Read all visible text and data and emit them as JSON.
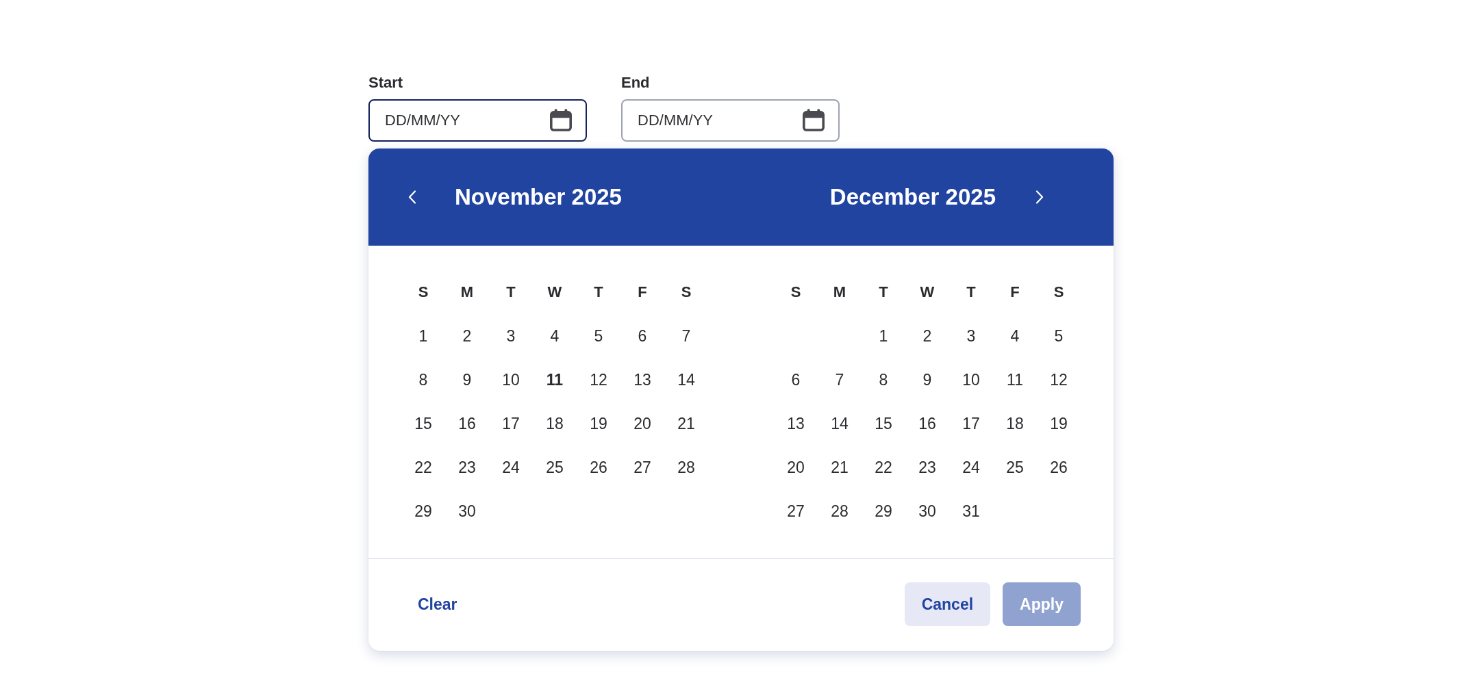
{
  "fields": [
    {
      "label": "Start",
      "placeholder": "DD/MM/YY",
      "focused": true
    },
    {
      "label": "End",
      "placeholder": "DD/MM/YY",
      "focused": false
    }
  ],
  "calendar": {
    "months": [
      {
        "title": "November 2025",
        "weekdays": [
          "S",
          "M",
          "T",
          "W",
          "T",
          "F",
          "S"
        ],
        "weeks": [
          [
            {
              "kind": "day",
              "label": "1",
              "today": false
            },
            {
              "kind": "day",
              "label": "2",
              "today": false
            },
            {
              "kind": "day",
              "label": "3",
              "today": false
            },
            {
              "kind": "day",
              "label": "4",
              "today": false
            },
            {
              "kind": "day",
              "label": "5",
              "today": false
            },
            {
              "kind": "day",
              "label": "6",
              "today": false
            },
            {
              "kind": "day",
              "label": "7",
              "today": false
            }
          ],
          [
            {
              "kind": "day",
              "label": "8",
              "today": false
            },
            {
              "kind": "day",
              "label": "9",
              "today": false
            },
            {
              "kind": "day",
              "label": "10",
              "today": false
            },
            {
              "kind": "day",
              "label": "11",
              "today": true
            },
            {
              "kind": "day",
              "label": "12",
              "today": false
            },
            {
              "kind": "day",
              "label": "13",
              "today": false
            },
            {
              "kind": "day",
              "label": "14",
              "today": false
            }
          ],
          [
            {
              "kind": "day",
              "label": "15",
              "today": false
            },
            {
              "kind": "day",
              "label": "16",
              "today": false
            },
            {
              "kind": "day",
              "label": "17",
              "today": false
            },
            {
              "kind": "day",
              "label": "18",
              "today": false
            },
            {
              "kind": "day",
              "label": "19",
              "today": false
            },
            {
              "kind": "day",
              "label": "20",
              "today": false
            },
            {
              "kind": "day",
              "label": "21",
              "today": false
            }
          ],
          [
            {
              "kind": "day",
              "label": "22",
              "today": false
            },
            {
              "kind": "day",
              "label": "23",
              "today": false
            },
            {
              "kind": "day",
              "label": "24",
              "today": false
            },
            {
              "kind": "day",
              "label": "25",
              "today": false
            },
            {
              "kind": "day",
              "label": "26",
              "today": false
            },
            {
              "kind": "day",
              "label": "27",
              "today": false
            },
            {
              "kind": "day",
              "label": "28",
              "today": false
            }
          ],
          [
            {
              "kind": "day",
              "label": "29",
              "today": false
            },
            {
              "kind": "day",
              "label": "30",
              "today": false
            }
          ]
        ]
      },
      {
        "title": "December 2025",
        "weekdays": [
          "S",
          "M",
          "T",
          "W",
          "T",
          "F",
          "S"
        ],
        "weeks": [
          [
            {
              "kind": "blank"
            },
            {
              "kind": "blank"
            },
            {
              "kind": "day",
              "label": "1",
              "today": false
            },
            {
              "kind": "day",
              "label": "2",
              "today": false
            },
            {
              "kind": "day",
              "label": "3",
              "today": false
            },
            {
              "kind": "day",
              "label": "4",
              "today": false
            },
            {
              "kind": "day",
              "label": "5",
              "today": false
            }
          ],
          [
            {
              "kind": "day",
              "label": "6",
              "today": false
            },
            {
              "kind": "day",
              "label": "7",
              "today": false
            },
            {
              "kind": "day",
              "label": "8",
              "today": false
            },
            {
              "kind": "day",
              "label": "9",
              "today": false
            },
            {
              "kind": "day",
              "label": "10",
              "today": false
            },
            {
              "kind": "day",
              "label": "11",
              "today": false
            },
            {
              "kind": "day",
              "label": "12",
              "today": false
            }
          ],
          [
            {
              "kind": "day",
              "label": "13",
              "today": false
            },
            {
              "kind": "day",
              "label": "14",
              "today": false
            },
            {
              "kind": "day",
              "label": "15",
              "today": false
            },
            {
              "kind": "day",
              "label": "16",
              "today": false
            },
            {
              "kind": "day",
              "label": "17",
              "today": false
            },
            {
              "kind": "day",
              "label": "18",
              "today": false
            },
            {
              "kind": "day",
              "label": "19",
              "today": false
            }
          ],
          [
            {
              "kind": "day",
              "label": "20",
              "today": false
            },
            {
              "kind": "day",
              "label": "21",
              "today": false
            },
            {
              "kind": "day",
              "label": "22",
              "today": false
            },
            {
              "kind": "day",
              "label": "23",
              "today": false
            },
            {
              "kind": "day",
              "label": "24",
              "today": false
            },
            {
              "kind": "day",
              "label": "25",
              "today": false
            },
            {
              "kind": "day",
              "label": "26",
              "today": false
            }
          ],
          [
            {
              "kind": "day",
              "label": "27",
              "today": false
            },
            {
              "kind": "day",
              "label": "28",
              "today": false
            },
            {
              "kind": "day",
              "label": "29",
              "today": false
            },
            {
              "kind": "day",
              "label": "30",
              "today": false
            },
            {
              "kind": "day",
              "label": "31",
              "today": false
            }
          ]
        ]
      }
    ]
  },
  "footer": {
    "buttons": [
      {
        "label": "Clear",
        "kind": "text",
        "disabled": false
      },
      {
        "label": "Cancel",
        "kind": "secondary",
        "disabled": false
      },
      {
        "label": "Apply",
        "kind": "primary",
        "disabled": true
      }
    ]
  }
}
